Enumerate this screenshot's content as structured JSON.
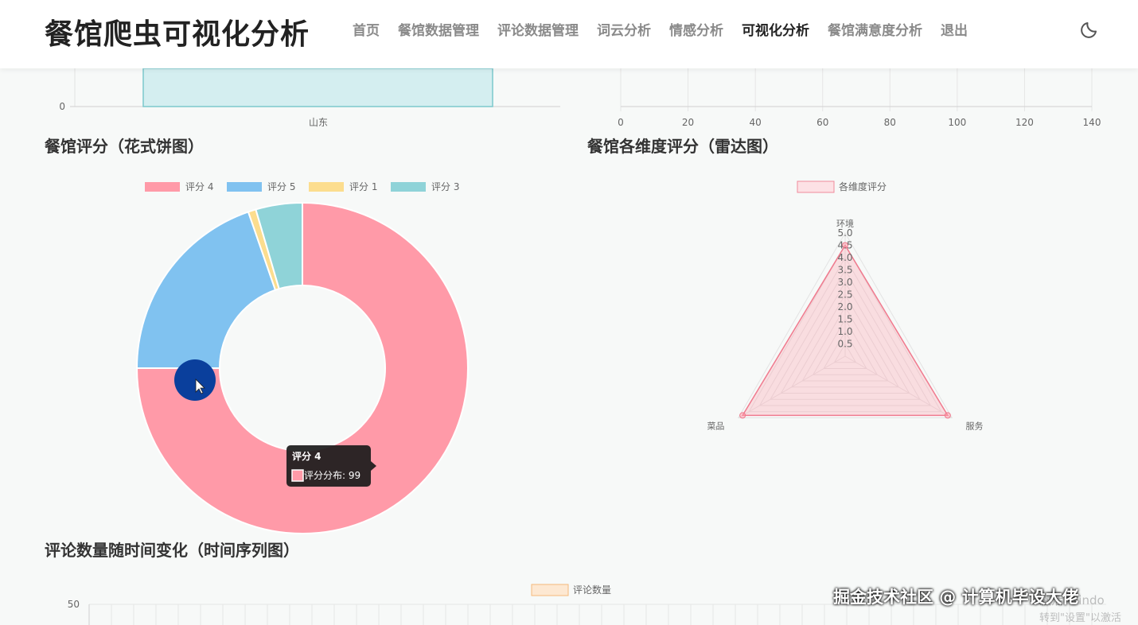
{
  "app": {
    "title": "餐馆爬虫可视化分析"
  },
  "nav": {
    "items": [
      "首页",
      "餐馆数据管理",
      "评论数据管理",
      "词云分析",
      "情感分析",
      "可视化分析",
      "餐馆满意度分析",
      "退出"
    ],
    "active_index": 5
  },
  "theme_icon": "moon-icon",
  "top_bar_chart": {
    "category": "山东",
    "y_tick": "0",
    "fill_color": "#d4eef0",
    "stroke_color": "#7cc8cc"
  },
  "top_hbar_chart": {
    "x_ticks": [
      "0",
      "20",
      "40",
      "60",
      "80",
      "100",
      "120",
      "140"
    ]
  },
  "sections": {
    "pie_title": "餐馆评分（花式饼图）",
    "radar_title": "餐馆各维度评分（雷达图）",
    "time_title": "评论数量随时间变化（时间序列图）"
  },
  "chart_data": [
    {
      "type": "pie",
      "legend": [
        "评分 4",
        "评分 5",
        "评分 1",
        "评分 3"
      ],
      "values": [
        99,
        26,
        1,
        6
      ],
      "colors": [
        "#ff9aa8",
        "#80c2f0",
        "#fcdd8e",
        "#8fd3d8"
      ],
      "tooltip": {
        "title": "评分 4",
        "label": "评分分布: 99"
      }
    },
    {
      "type": "radar",
      "legend": [
        "各维度评分"
      ],
      "axes": [
        "环境",
        "服务",
        "菜品"
      ],
      "values": [
        4.5,
        4.8,
        4.8
      ],
      "ticks": [
        "0.5",
        "1.0",
        "1.5",
        "2.0",
        "2.5",
        "3.0",
        "3.5",
        "4.0",
        "4.5",
        "5.0"
      ],
      "max": 5.0
    },
    {
      "type": "line",
      "legend": [
        "评论数量"
      ],
      "y_tick": "50"
    }
  ],
  "watermark": "掘金技术社区 @ 计算机毕设大佬",
  "windows_ghost": [
    "激活 Windo",
    "转到\"设置\"以激活"
  ]
}
